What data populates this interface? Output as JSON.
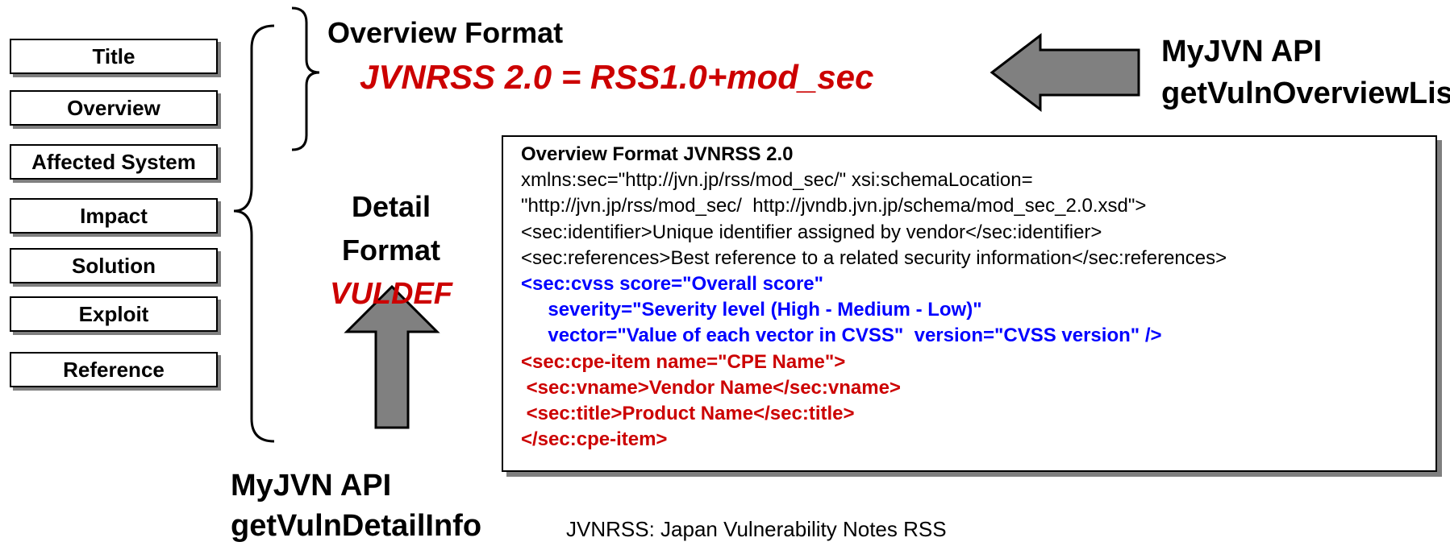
{
  "categories": [
    "Title",
    "Overview",
    "Affected System",
    "Impact",
    "Solution",
    "Exploit",
    "Reference"
  ],
  "overview": {
    "heading": "Overview Format",
    "formula": "JVNRSS 2.0 = RSS1.0+mod_sec"
  },
  "detail": {
    "line1": "Detail",
    "line2": "Format",
    "format_name": "VULDEF"
  },
  "api_overview": {
    "line1": "MyJVN API",
    "line2": "getVulnOverviewList"
  },
  "api_detail": {
    "line1": "MyJVN API",
    "line2": "getVulnDetailInfo"
  },
  "code": {
    "title": "Overview Format JVNRSS 2.0",
    "lines": [
      "xmlns:sec=\"http://jvn.jp/rss/mod_sec/\" xsi:schemaLocation=",
      "\"http://jvn.jp/rss/mod_sec/  http://jvndb.jvn.jp/schema/mod_sec_2.0.xsd\">",
      "<sec:identifier>Unique identifier assigned by vendor</sec:identifier>",
      "<sec:references>Best reference to a related security information</sec:references>"
    ],
    "cvss_lines": [
      "<sec:cvss score=\"Overall score\"",
      "     severity=\"Severity level (High - Medium - Low)\"",
      "     vector=\"Value of each vector in CVSS\"  version=\"CVSS version\" />"
    ],
    "cpe_lines": [
      "<sec:cpe-item name=\"CPE Name\">",
      " <sec:vname>Vendor Name</sec:vname>",
      " <sec:title>Product Name</sec:title>",
      "</sec:cpe-item>"
    ]
  },
  "footnote": "JVNRSS: Japan Vulnerability Notes RSS",
  "colors": {
    "red": "#cc0000",
    "blue": "#0000ff",
    "arrow_fill": "#808080"
  }
}
